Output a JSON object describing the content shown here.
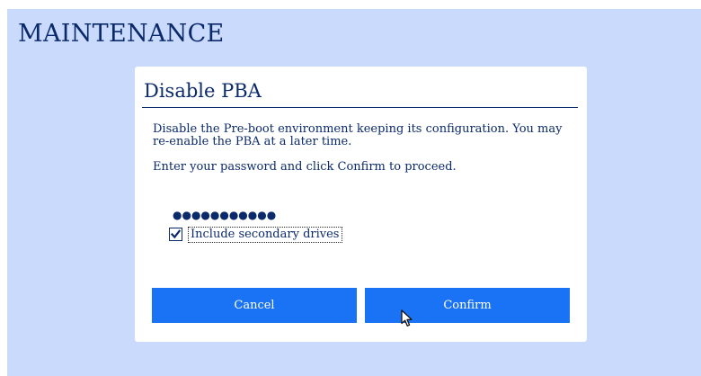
{
  "page": {
    "title": "MAINTENANCE"
  },
  "dialog": {
    "title": "Disable PBA",
    "description": "Disable the Pre-boot environment keeping its configuration. You may re-enable the PBA at a later time.",
    "instruction": "Enter your password and click Confirm to proceed.",
    "password_mask": "●●●●●●●●●●●",
    "include_secondary": {
      "label": "Include secondary drives",
      "checked": true
    },
    "buttons": {
      "cancel_label": "Cancel",
      "confirm_label": "Confirm"
    }
  },
  "colors": {
    "background": "#c9dafc",
    "text": "#0b2a6b",
    "button": "#1a73f5"
  },
  "icons": {
    "cursor": "mouse-pointer-icon",
    "check": "checkmark-icon"
  }
}
